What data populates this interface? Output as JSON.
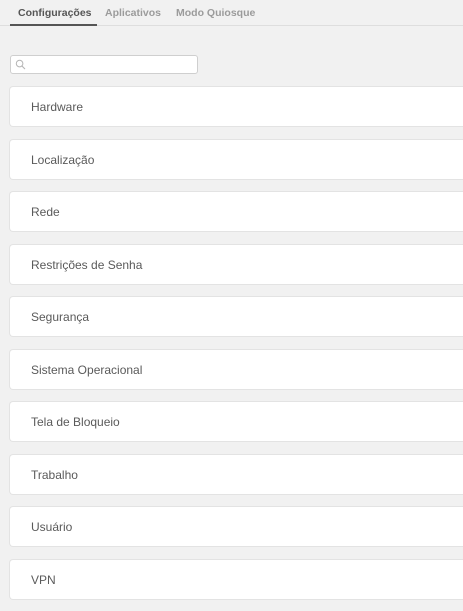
{
  "tabs": [
    {
      "label": "Configurações",
      "active": true
    },
    {
      "label": "Aplicativos",
      "active": false
    },
    {
      "label": "Modo Quiosque",
      "active": false
    }
  ],
  "search": {
    "value": "",
    "placeholder": ""
  },
  "items": [
    {
      "label": "Hardware"
    },
    {
      "label": "Localização"
    },
    {
      "label": "Rede"
    },
    {
      "label": "Restrições de Senha"
    },
    {
      "label": "Segurança"
    },
    {
      "label": "Sistema Operacional"
    },
    {
      "label": "Tela de Bloqueio"
    },
    {
      "label": "Trabalho"
    },
    {
      "label": "Usuário"
    },
    {
      "label": "VPN"
    }
  ],
  "colors": {
    "background": "#f1f1f1",
    "active_tab": "#555555",
    "inactive_tab": "#9b9b9b",
    "item_text": "#5a5a5a"
  }
}
